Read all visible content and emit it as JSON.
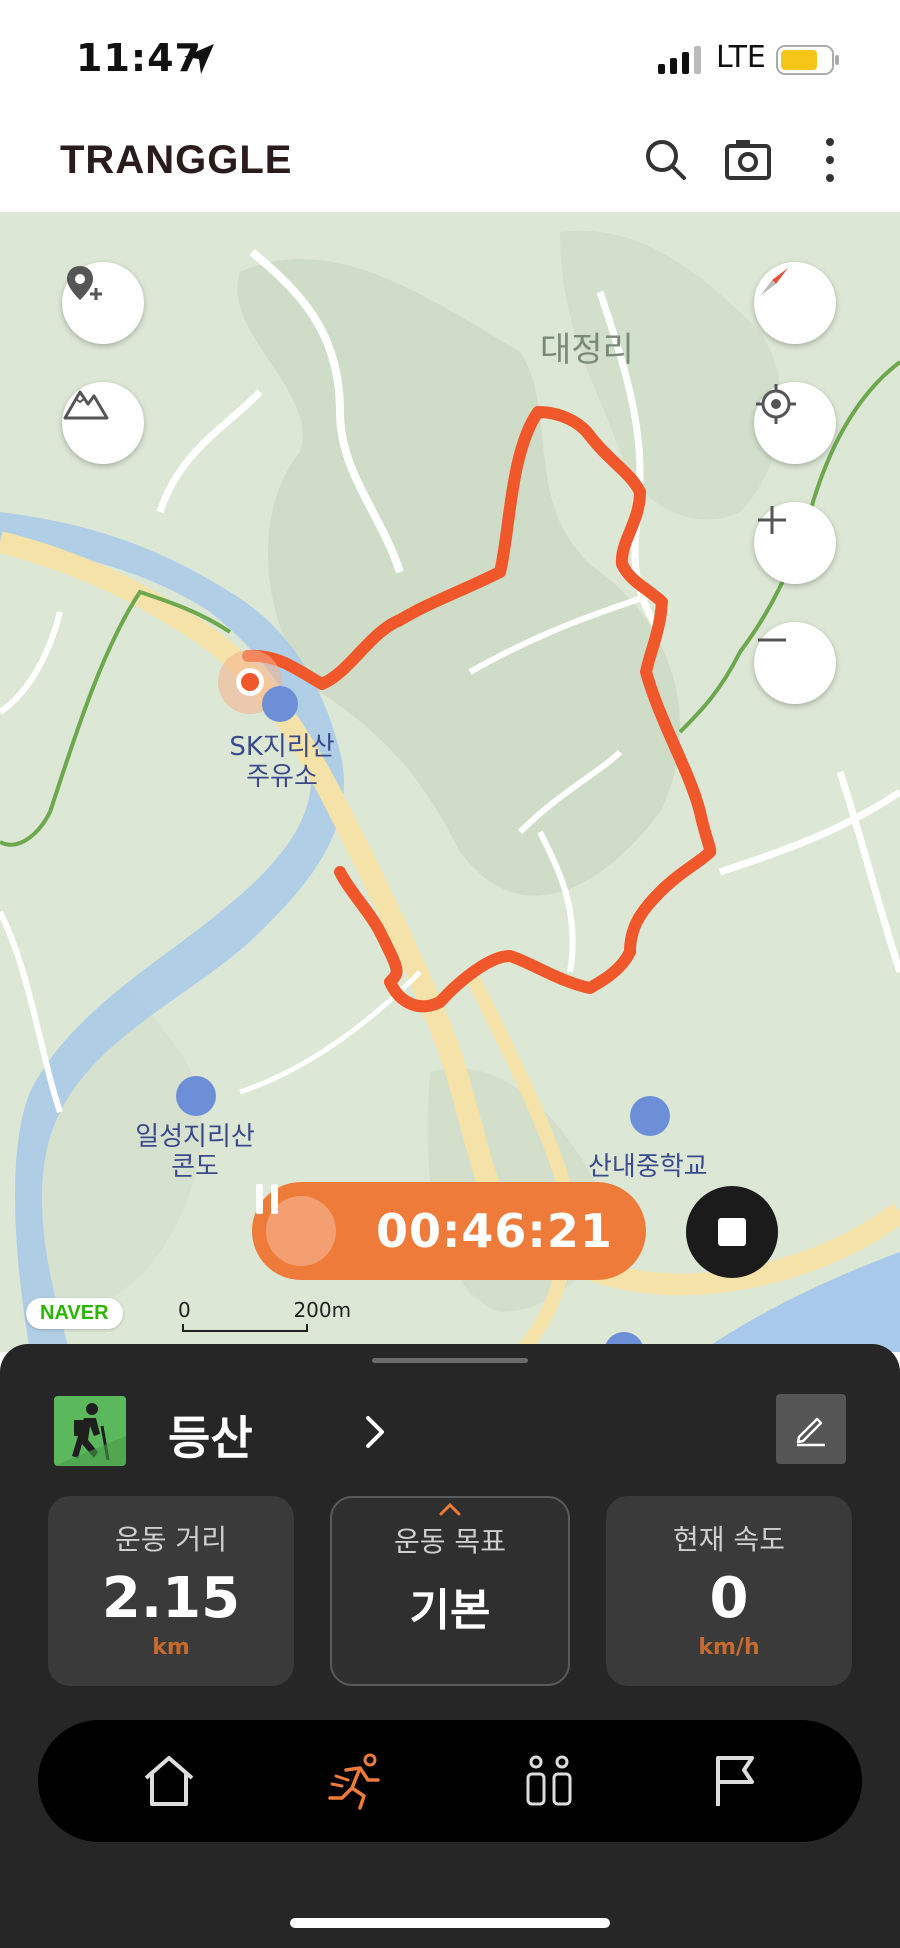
{
  "status_bar": {
    "time": "11:47",
    "network": "LTE",
    "battery_color": "#f5c518"
  },
  "app": {
    "brand": "TRANGGLE",
    "icons": [
      "search-icon",
      "camera-icon",
      "more-vertical-icon"
    ]
  },
  "map": {
    "places": [
      {
        "name": "대정리"
      },
      {
        "name_line1": "SK지리산",
        "name_line2": "주유소"
      },
      {
        "name_line1": "일성지리산",
        "name_line2": "콘도"
      },
      {
        "name": "산내중학교"
      }
    ],
    "scale": {
      "start": "0",
      "end": "200m"
    },
    "provider": "NAVER",
    "route_color": "#f0572b",
    "buttons": [
      "add-location-icon",
      "mountain-icon",
      "compass-icon",
      "my-location-icon",
      "zoom-in-icon",
      "zoom-out-icon"
    ]
  },
  "tracking": {
    "elapsed": "00:46:21",
    "accent": "#ef7b3b"
  },
  "activity": {
    "title": "등산",
    "icon": "hiking-icon"
  },
  "stats": {
    "distance": {
      "label": "운동 거리",
      "value": "2.15",
      "unit": "km"
    },
    "goal": {
      "label": "운동 목표",
      "value": "기본"
    },
    "speed": {
      "label": "현재 속도",
      "value": "0",
      "unit": "km/h"
    }
  },
  "bottom_nav": {
    "items": [
      "home-icon",
      "running-icon",
      "people-icon",
      "flag-icon"
    ],
    "active": "running-icon",
    "active_color": "#ef7b3b"
  }
}
